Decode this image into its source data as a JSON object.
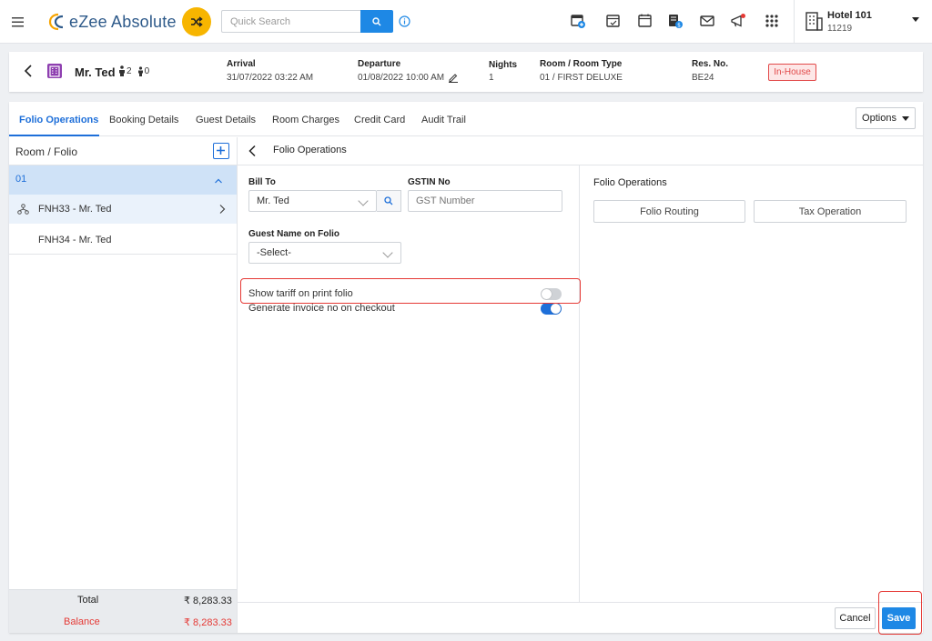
{
  "app": {
    "logo_text": "eZee Absolute"
  },
  "search": {
    "placeholder": "Quick Search"
  },
  "hotel": {
    "name": "Hotel 101",
    "code": "11219"
  },
  "guest": {
    "name": "Mr. Ted",
    "adults": "2",
    "children": "0",
    "arrival_label": "Arrival",
    "arrival_value": "31/07/2022 03:22 AM",
    "departure_label": "Departure",
    "departure_value": "01/08/2022 10:00 AM",
    "nights_label": "Nights",
    "nights_value": "1",
    "room_label": "Room / Room Type",
    "room_value": "01 / FIRST DELUXE",
    "resno_label": "Res. No.",
    "resno_value": "BE24",
    "status": "In-House"
  },
  "tabs": [
    {
      "label": "Folio Operations"
    },
    {
      "label": "Booking Details"
    },
    {
      "label": "Guest Details"
    },
    {
      "label": "Room Charges"
    },
    {
      "label": "Credit Card"
    },
    {
      "label": "Audit Trail"
    }
  ],
  "options_label": "Options",
  "left_panel": {
    "title": "Room / Folio",
    "room": "01",
    "folios": [
      {
        "label": "FNH33 - Mr. Ted"
      },
      {
        "label": "FNH34 - Mr. Ted"
      }
    ],
    "total_label": "Total",
    "total_value": "₹ 8,283.33",
    "balance_label": "Balance",
    "balance_value": "₹ 8,283.33"
  },
  "content": {
    "title": "Folio Operations",
    "bill_to_label": "Bill To",
    "bill_to_value": "Mr. Ted",
    "gstin_label": "GSTIN No",
    "gstin_placeholder": "GST Number",
    "guest_name_label": "Guest Name on Folio",
    "guest_name_value": "-Select-",
    "toggles": [
      {
        "label": "Show tariff on print folio",
        "on": false
      },
      {
        "label": "Generate invoice no on checkout",
        "on": true
      }
    ],
    "ops_title": "Folio Operations",
    "ops_buttons": [
      {
        "label": "Folio Routing"
      },
      {
        "label": "Tax Operation"
      }
    ]
  },
  "footer": {
    "cancel_label": "Cancel",
    "save_label": "Save"
  },
  "colors": {
    "accent": "#1e88e5",
    "highlight": "#e53935",
    "status": "#e24a4a",
    "shuffle": "#f7b500"
  }
}
